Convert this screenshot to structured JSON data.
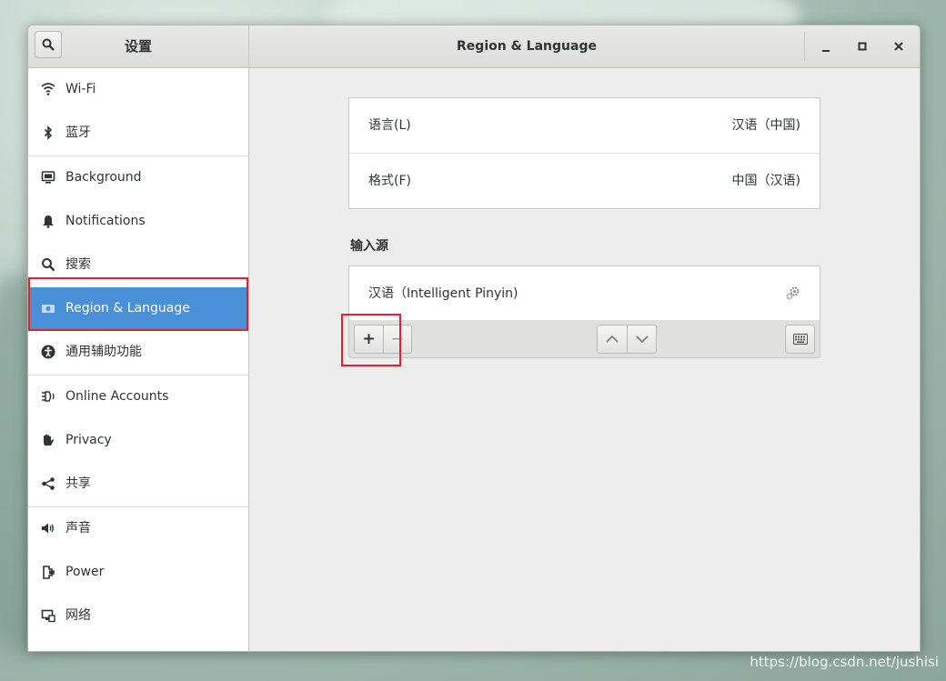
{
  "header": {
    "app_title": "设置",
    "window_title": "Region & Language",
    "minimize": "_",
    "maximize": "□",
    "close": "×"
  },
  "sidebar": {
    "items": [
      {
        "label": "Wi-Fi",
        "icon": "wifi-icon"
      },
      {
        "label": "蓝牙",
        "icon": "bluetooth-icon"
      },
      {
        "label": "Background",
        "icon": "background-icon"
      },
      {
        "label": "Notifications",
        "icon": "bell-icon"
      },
      {
        "label": "搜索",
        "icon": "search-icon"
      },
      {
        "label": "Region & Language",
        "icon": "region-flag-icon",
        "selected": true
      },
      {
        "label": "通用辅助功能",
        "icon": "accessibility-icon"
      },
      {
        "label": "Online Accounts",
        "icon": "online-accounts-icon"
      },
      {
        "label": "Privacy",
        "icon": "hand-icon"
      },
      {
        "label": "共享",
        "icon": "share-icon"
      },
      {
        "label": "声音",
        "icon": "speaker-icon"
      },
      {
        "label": "Power",
        "icon": "power-icon"
      },
      {
        "label": "网络",
        "icon": "network-icon"
      }
    ]
  },
  "main": {
    "language_label": "语言(L)",
    "language_value": "汉语（中国)",
    "formats_label": "格式(F)",
    "formats_value": "中国（汉语)",
    "input_sources_heading": "输入源",
    "input_source": "汉语（Intelligent Pinyin)",
    "add_label": "+",
    "remove_label": "−"
  },
  "watermark": "https://blog.csdn.net/jushisi",
  "colors": {
    "accent": "#4a90d9",
    "highlight_box": "#e3222b"
  }
}
